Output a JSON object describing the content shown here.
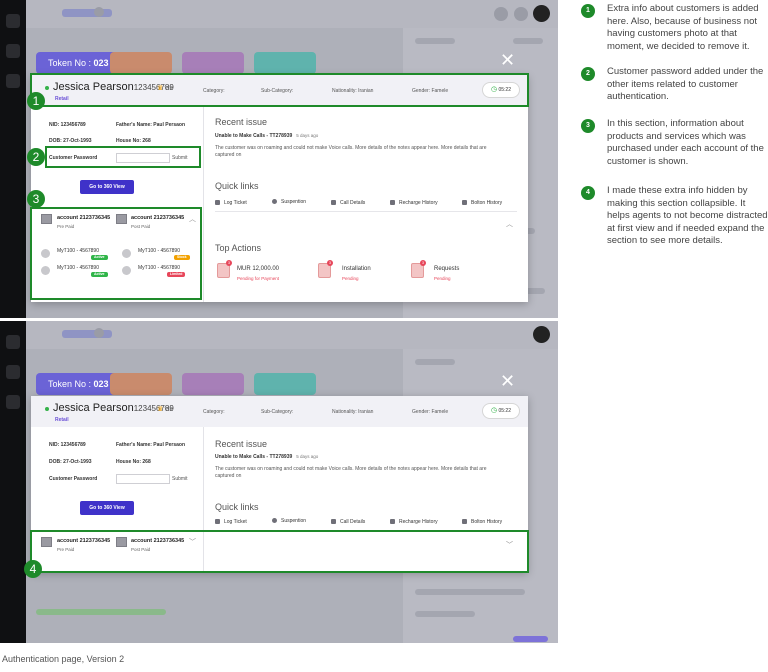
{
  "screen1": {
    "token": {
      "label": "Token No :",
      "value": "023"
    },
    "customer": {
      "name": "Jessica Pearson",
      "number": "123456789",
      "tier": "VIP",
      "segment": "Retail"
    },
    "header_fields": {
      "category": "Category:",
      "sub_category": "Sub-Category:",
      "nationality": "Nationality: Iranian",
      "gender": "Gender: Famele"
    },
    "timer": "05:22",
    "info": {
      "nid": "NID: 123456789",
      "father": "Father's Name: Paul Persaon",
      "dob": "DOB: 27-Oct-1993",
      "house": "House No: 268"
    },
    "password": {
      "label": "Customer Password",
      "submit": "Submit"
    },
    "view360": "Go to 360 View",
    "accounts": [
      {
        "name": "account 2123736345",
        "type": "Pre Paid"
      },
      {
        "name": "account 2123736345",
        "type": "Post Paid"
      }
    ],
    "services": [
      {
        "name": "MyT100 - 4567890",
        "badge": "Active"
      },
      {
        "name": "MyT100 - 4567890",
        "badge": "Stock"
      },
      {
        "name": "MyT100 - 4567890",
        "badge": "Active"
      },
      {
        "name": "MyT100 - 4567890",
        "badge": "Limited"
      }
    ],
    "recent_issue": {
      "title": "Recent issue",
      "issue": "Unable to Make Calls - TT278939",
      "time": "5 days ago",
      "desc": "The customer was on roaming and could not make  Voice calls. More details of the notes appear here. More details that are captured on"
    },
    "quick_links": {
      "title": "Quick links",
      "items": [
        "Log Ticket",
        "Suspention",
        "Call Details",
        "Recharge History",
        "Bolton History"
      ]
    },
    "top_actions": {
      "title": "Top Actions",
      "items": [
        {
          "label": "MUR 12,000.00",
          "sub": "Pending for Payment",
          "count": "3"
        },
        {
          "label": "Installation",
          "sub": "Pending",
          "count": "3"
        },
        {
          "label": "Requests",
          "sub": "Pending",
          "count": "3"
        }
      ]
    },
    "callouts": [
      "1",
      "2",
      "3"
    ]
  },
  "screen2": {
    "token": {
      "label": "Token No :",
      "value": "023"
    },
    "customer": {
      "name": "Jessica Pearson",
      "number": "123456789",
      "tier": "VIP",
      "segment": "Retail"
    },
    "header_fields": {
      "category": "Category:",
      "sub_category": "Sub-Category:",
      "nationality": "Nationality: Iranian",
      "gender": "Gender: Famele"
    },
    "timer": "05:22",
    "info": {
      "nid": "NID: 123456789",
      "father": "Father's Name: Paul Persaon",
      "dob": "DOB: 27-Oct-1993",
      "house": "House No: 268"
    },
    "password": {
      "label": "Customer Password",
      "submit": "Submit"
    },
    "view360": "Go to 360 View",
    "accounts": [
      {
        "name": "account 2123736345",
        "type": "Pre Paid"
      },
      {
        "name": "account 2123736345",
        "type": "Post Paid"
      }
    ],
    "recent_issue": {
      "title": "Recent issue",
      "issue": "Unable to Make Calls - TT278939",
      "time": "5 days ago",
      "desc": "The customer was on roaming and could not make  Voice calls. More details of the notes appear here. More details that are captured on"
    },
    "quick_links": {
      "title": "Quick links",
      "items": [
        "Log Ticket",
        "Suspention",
        "Call Details",
        "Recharge History",
        "Bolton History"
      ]
    },
    "callout": "4"
  },
  "notes": [
    {
      "n": "1",
      "text": "Extra info about customers is added here. Also, because of business not having customers photo at that moment, we decided to remove it."
    },
    {
      "n": "2",
      "text": "Customer password added under the other items related to customer authentication."
    },
    {
      "n": "3",
      "text": "In this section, information about products and services which was purchased under each account of the customer is shown."
    },
    {
      "n": "4",
      "text": "I made these extra info hidden by making this section collapsible. It helps agents to not become distracted at first view and if needed expand the section to see more details."
    }
  ],
  "caption": "Authentication page, Version 2",
  "colors": {
    "highlight": "#1e8a2a",
    "brand": "#3f32c9",
    "active": "#30b549",
    "warning": "#e7465a"
  }
}
